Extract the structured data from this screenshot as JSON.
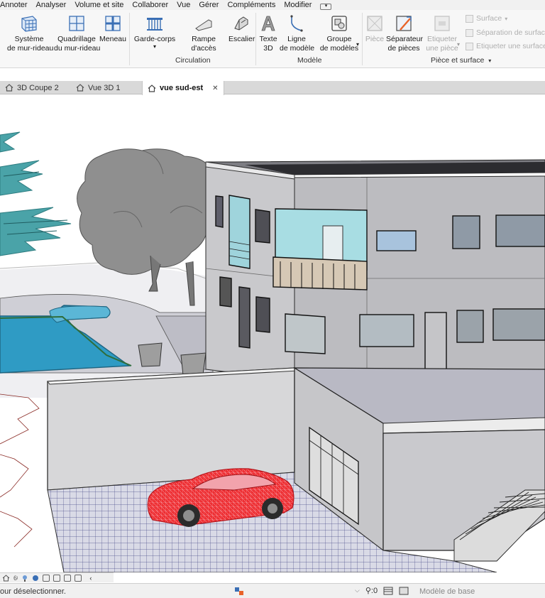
{
  "menu": {
    "items": [
      "Annoter",
      "Analyser",
      "Volume et site",
      "Collaborer",
      "Vue",
      "Gérer",
      "Compléments",
      "Modifier"
    ]
  },
  "ribbon": {
    "buttons": {
      "systeme_mur_rideau": "Système\nde mur-rideau",
      "quadrillage_mur_rideau": "Quadrillage\ndu mur-rideau",
      "meneau": "Meneau",
      "garde_corps": "Garde-corps",
      "rampe_acces": "Rampe d'accès",
      "escalier": "Escalier",
      "texte_3d": "Texte\n3D",
      "ligne_modele": "Ligne\nde modèle",
      "groupe_modeles": "Groupe\nde modèles",
      "piece": "Pièce",
      "separateur_pieces": "Séparateur\nde pièces",
      "etiqueter_piece": "Etiqueter\nune pièce"
    },
    "small": {
      "surface": "Surface",
      "separation_surface": "Séparation  de surface",
      "etiqueter_surface": "Etiqueter  une surface"
    },
    "panels": {
      "circulation": "Circulation",
      "modele": "Modèle",
      "piece_surface": "Pièce et surface"
    }
  },
  "tabs": [
    {
      "label": "3D Coupe 2",
      "active": false
    },
    {
      "label": "Vue 3D 1",
      "active": false
    },
    {
      "label": "vue sud-est",
      "active": true
    }
  ],
  "status": {
    "message": "our déselectionner.",
    "filter_count": ":0",
    "model": "Modèle de base"
  },
  "colors": {
    "accent_blue": "#2b579a",
    "pool_water": "#2f9bc4",
    "car_red": "#e8262a",
    "glass": "#9fd4dc",
    "pine": "#3a8f95"
  }
}
